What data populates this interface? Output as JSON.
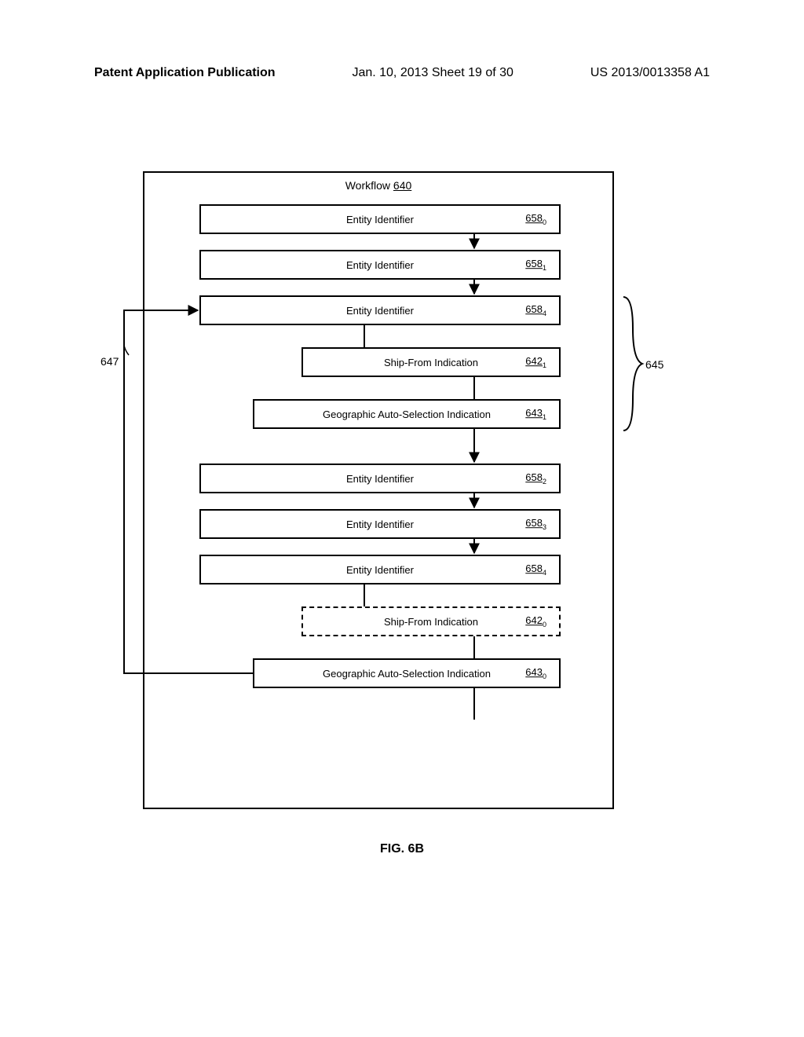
{
  "header": {
    "pub": "Patent Application Publication",
    "date_sheet": "Jan. 10, 2013  Sheet 19 of 30",
    "num": "US 2013/0013358 A1"
  },
  "workflow": {
    "title_label": "Workflow",
    "title_ref": "640"
  },
  "blocks": {
    "b658_0": {
      "label": "Entity Identifier",
      "ref": "658",
      "sub": "0"
    },
    "b658_1": {
      "label": "Entity Identifier",
      "ref": "658",
      "sub": "1"
    },
    "b658_4a": {
      "label": "Entity Identifier",
      "ref": "658",
      "sub": "4"
    },
    "b642_1": {
      "label": "Ship-From Indication",
      "ref": "642",
      "sub": "1"
    },
    "b643_1": {
      "label": "Geographic Auto-Selection Indication",
      "ref": "643",
      "sub": "1"
    },
    "b658_2": {
      "label": "Entity Identifier",
      "ref": "658",
      "sub": "2"
    },
    "b658_3": {
      "label": "Entity Identifier",
      "ref": "658",
      "sub": "3"
    },
    "b658_4b": {
      "label": "Entity Identifier",
      "ref": "658",
      "sub": "4"
    },
    "b642_0": {
      "label": "Ship-From Indication",
      "ref": "642",
      "sub": "0"
    },
    "b643_0": {
      "label": "Geographic Auto-Selection Indication",
      "ref": "643",
      "sub": "0"
    }
  },
  "labels": {
    "loop_ref": "647",
    "brace_ref": "645"
  },
  "caption": "FIG. 6B"
}
